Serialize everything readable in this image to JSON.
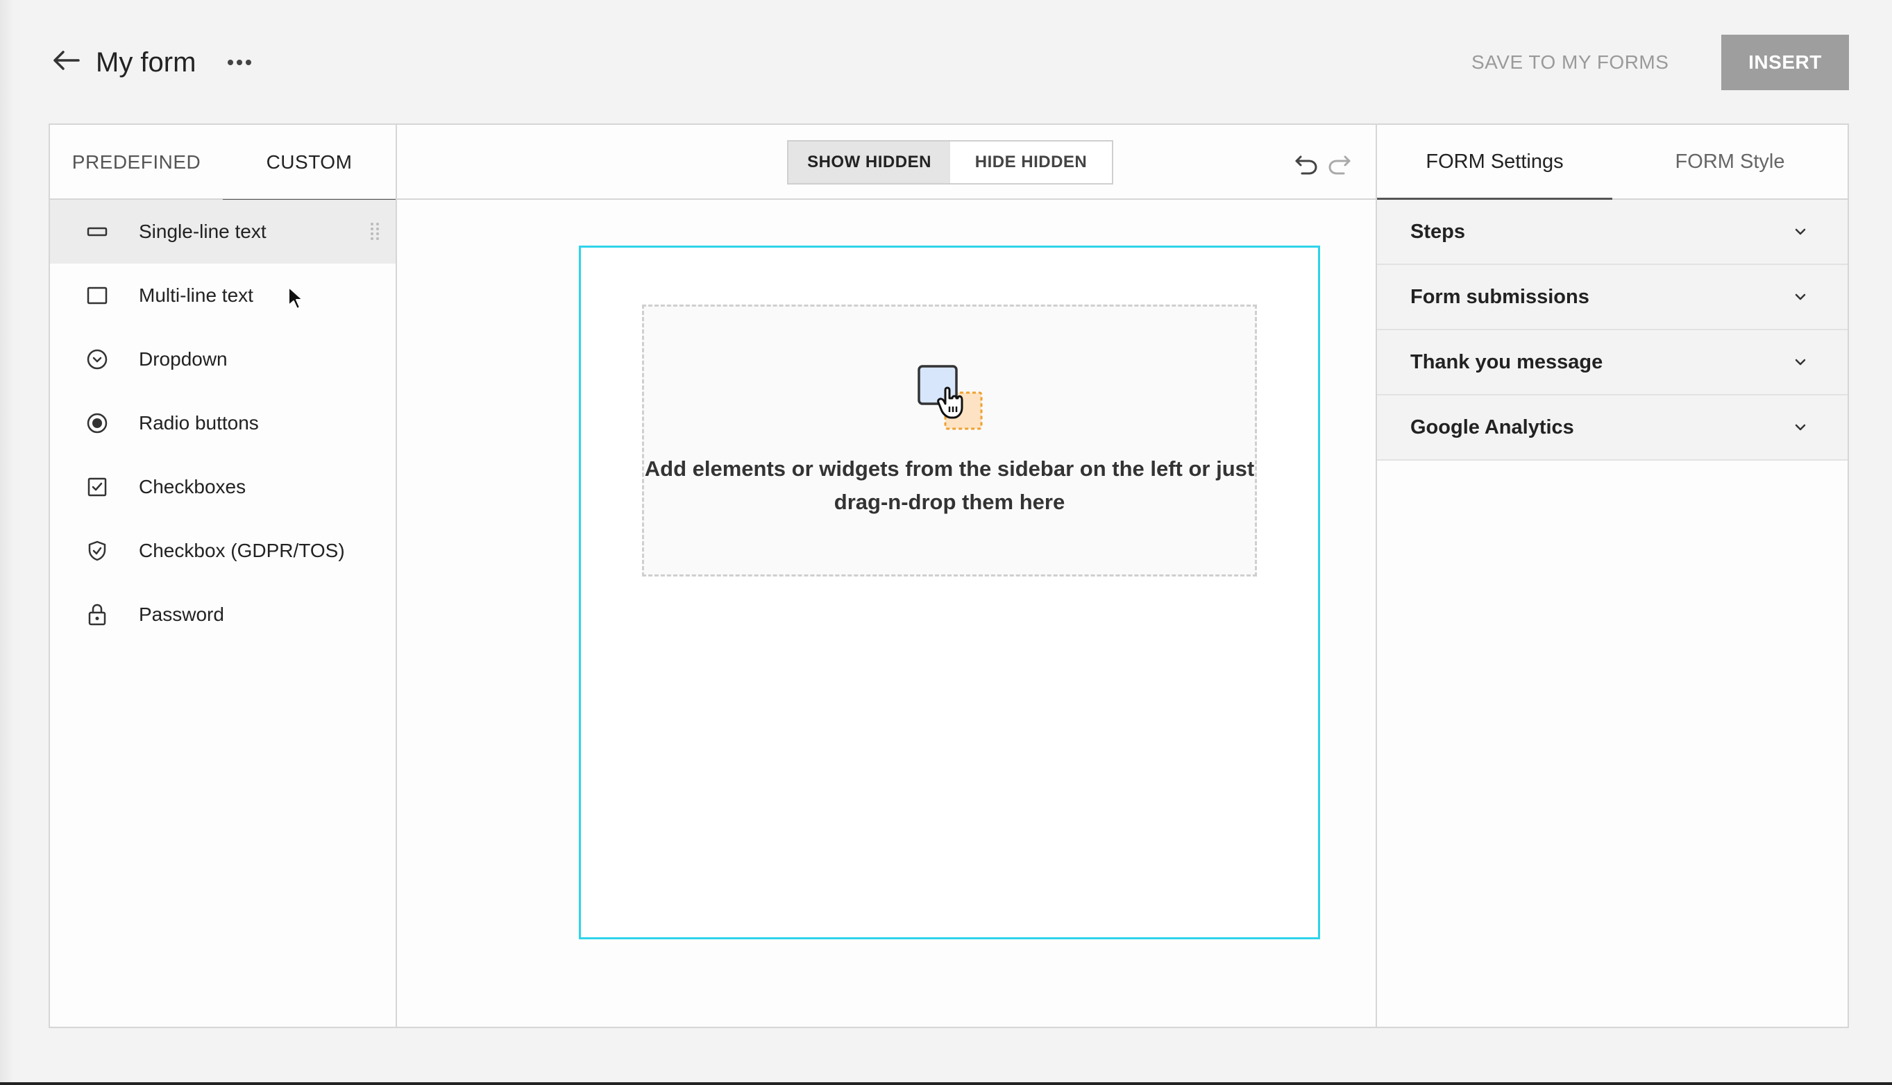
{
  "header": {
    "title": "My form",
    "save_label": "SAVE TO MY FORMS",
    "insert_label": "INSERT"
  },
  "left_panel": {
    "tabs": [
      {
        "label": "PREDEFINED",
        "active": false
      },
      {
        "label": "CUSTOM",
        "active": true
      }
    ],
    "items": [
      {
        "label": "Single-line text",
        "icon": "single-line-icon"
      },
      {
        "label": "Multi-line text",
        "icon": "multi-line-icon"
      },
      {
        "label": "Dropdown",
        "icon": "dropdown-icon"
      },
      {
        "label": "Radio buttons",
        "icon": "radio-icon"
      },
      {
        "label": "Checkboxes",
        "icon": "checkbox-icon"
      },
      {
        "label": "Checkbox (GDPR/TOS)",
        "icon": "shield-check-icon"
      },
      {
        "label": "Password",
        "icon": "lock-icon"
      }
    ]
  },
  "center": {
    "toggle": {
      "show_hidden": "SHOW HIDDEN",
      "hide_hidden": "HIDE HIDDEN"
    },
    "dropzone_text": "Add elements or widgets from the sidebar on the left or just drag-n-drop them here",
    "accent": "#2ed4ea"
  },
  "right_panel": {
    "tabs": [
      {
        "label": "FORM Settings",
        "active": true
      },
      {
        "label": "FORM Style",
        "active": false
      }
    ],
    "sections": [
      {
        "label": "Steps"
      },
      {
        "label": "Form submissions"
      },
      {
        "label": "Thank you message"
      },
      {
        "label": "Google Analytics"
      }
    ]
  }
}
